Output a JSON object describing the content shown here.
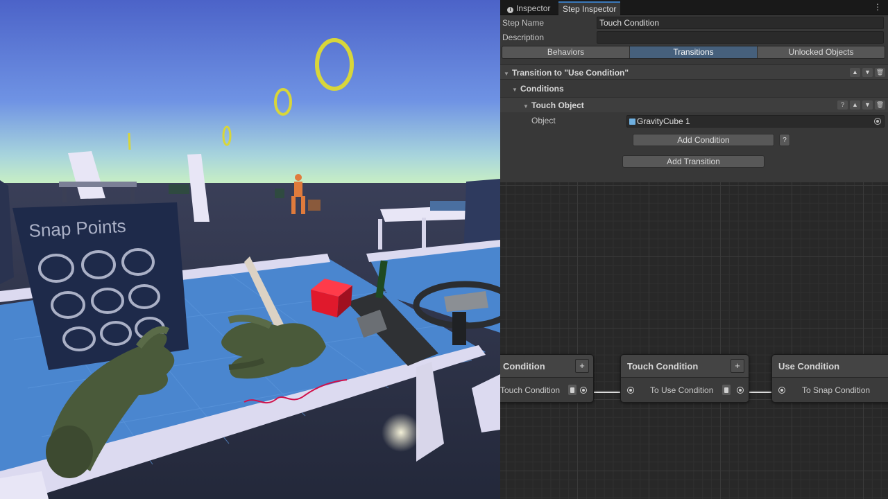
{
  "viewport": {
    "snap_panel_title": "Snap Points",
    "colors": {
      "sky_top": "#4f66c9",
      "sky_horizon": "#b6e3c8",
      "floor": "#2a3244",
      "table_top": "#4a86cf",
      "table_edge": "#dcdaf0",
      "ring": "#d8d63a",
      "cube": "#e0192c",
      "hand": "#4a5a3a",
      "panel": "#1e2a4a"
    }
  },
  "editor": {
    "tabs": [
      {
        "label": "Inspector",
        "icon": "info-icon"
      },
      {
        "label": "Step Inspector"
      }
    ],
    "menu_icon": "⋮",
    "step_name_label": "Step Name",
    "step_name_value": "Touch Condition",
    "description_label": "Description",
    "description_value": "",
    "toggles": [
      "Behaviors",
      "Transitions",
      "Unlocked Objects"
    ],
    "active_toggle": "Transitions",
    "transition_header": "Transition to \"Use Condition\"",
    "conditions_header": "Conditions",
    "condition_header": "Touch Object",
    "object_label": "Object",
    "object_value": "GravityCube 1",
    "add_condition": "Add Condition",
    "help": "?",
    "add_transition": "Add Transition",
    "mini_buttons": {
      "help": "?",
      "up": "▲",
      "down": "▼",
      "delete": "🗑"
    },
    "accent_color": "#46607c"
  },
  "graph": {
    "nodes": [
      {
        "title": "Condition",
        "port_label": "Touch Condition",
        "plus": "+"
      },
      {
        "title": "Touch Condition",
        "port_label": "To Use Condition",
        "plus": "+"
      },
      {
        "title": "Use Condition",
        "port_label": "To Snap Condition",
        "plus": "+"
      }
    ]
  }
}
